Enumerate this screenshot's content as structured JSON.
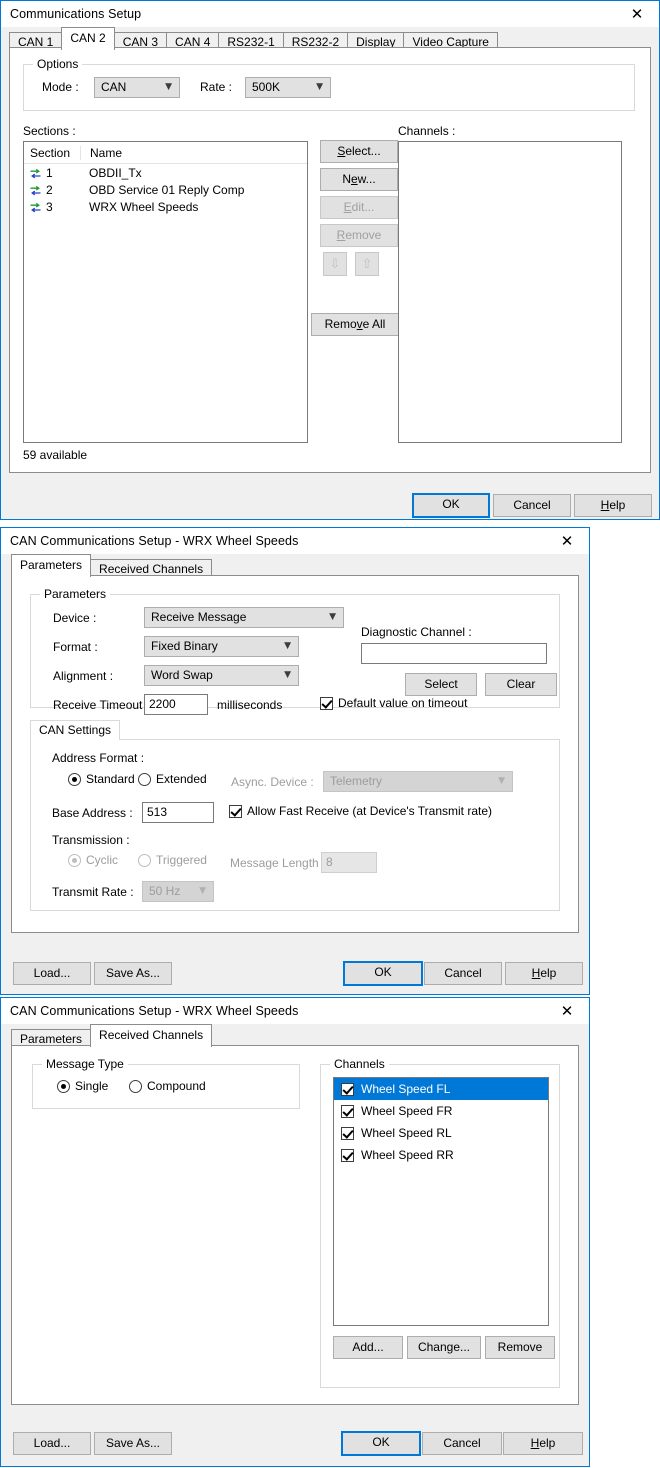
{
  "comm_setup": {
    "title": "Communications Setup",
    "close_icon": "close-icon",
    "tabs": [
      {
        "label": "CAN 1",
        "active": false
      },
      {
        "label": "CAN 2",
        "active": true
      },
      {
        "label": "CAN 3",
        "active": false
      },
      {
        "label": "CAN 4",
        "active": false
      },
      {
        "label": "RS232-1",
        "active": false
      },
      {
        "label": "RS232-2",
        "active": false
      },
      {
        "label": "Display",
        "active": false
      },
      {
        "label": "Video Capture",
        "active": false
      }
    ],
    "options": {
      "group_label": "Options",
      "mode_label": "Mode :",
      "mode_value": "CAN",
      "rate_label": "Rate :",
      "rate_value": "500K"
    },
    "sections": {
      "label": "Sections :",
      "columns": [
        "Section",
        "Name"
      ],
      "rows": [
        {
          "icon": "transfer-arrows-icon",
          "num": "1",
          "name": "OBDII_Tx"
        },
        {
          "icon": "transfer-arrows-icon",
          "num": "2",
          "name": "OBD Service 01 Reply Comp"
        },
        {
          "icon": "transfer-arrows-icon",
          "num": "3",
          "name": "WRX Wheel Speeds"
        }
      ],
      "status": "59 available"
    },
    "channels": {
      "label": "Channels :",
      "items": []
    },
    "side_buttons": [
      {
        "label": "Select...",
        "mnemonic": "S",
        "enabled": true
      },
      {
        "label": "New...",
        "mnemonic": "e",
        "enabled": true
      },
      {
        "label": "Edit...",
        "mnemonic": "E",
        "enabled": false
      },
      {
        "label": "Remove",
        "mnemonic": "R",
        "enabled": false
      }
    ],
    "move_down_icon": "arrow-down-icon",
    "move_up_icon": "arrow-up-icon",
    "remove_all_label": "Remove All",
    "footer": {
      "ok": "OK",
      "cancel": "Cancel",
      "help": "Help"
    }
  },
  "can_params": {
    "title": "CAN Communications Setup - WRX Wheel Speeds",
    "close_icon": "close-icon",
    "tabs": [
      {
        "label": "Parameters",
        "active": true
      },
      {
        "label": "Received Channels",
        "active": false
      }
    ],
    "parameters": {
      "group_label": "Parameters",
      "device_label": "Device :",
      "device_value": "Receive Message",
      "format_label": "Format :",
      "format_value": "Fixed Binary",
      "alignment_label": "Alignment :",
      "alignment_value": "Word Swap",
      "timeout_label": "Receive Timeout :",
      "timeout_value": "2200",
      "timeout_units": "milliseconds",
      "default_on_timeout_label": "Default value on timeout",
      "default_on_timeout_checked": true,
      "diagnostic_label": "Diagnostic Channel :",
      "diagnostic_value": "",
      "select_label": "Select",
      "clear_label": "Clear"
    },
    "can_settings": {
      "tab_label": "CAN Settings",
      "address_format_label": "Address Format :",
      "standard_label": "Standard",
      "standard_selected": true,
      "extended_label": "Extended",
      "async_device_label": "Async. Device :",
      "async_device_value": "Telemetry",
      "async_device_enabled": false,
      "base_address_label": "Base Address :",
      "base_address_value": "513",
      "fast_receive_label": "Allow Fast Receive (at Device's Transmit rate)",
      "fast_receive_checked": true,
      "transmission_label": "Transmission :",
      "cyclic_label": "Cyclic",
      "cyclic_selected": true,
      "triggered_label": "Triggered",
      "message_length_label": "Message Length :",
      "message_length_value": "8",
      "transmit_rate_label": "Transmit Rate :",
      "transmit_rate_value": "50 Hz",
      "transmission_enabled": false
    },
    "footer": {
      "load": "Load...",
      "save_as": "Save As...",
      "ok": "OK",
      "cancel": "Cancel",
      "help": "Help"
    }
  },
  "can_received": {
    "title": "CAN Communications Setup - WRX Wheel Speeds",
    "close_icon": "close-icon",
    "tabs": [
      {
        "label": "Parameters",
        "active": false
      },
      {
        "label": "Received Channels",
        "active": true
      }
    ],
    "message_type": {
      "group_label": "Message Type",
      "single_label": "Single",
      "single_selected": true,
      "compound_label": "Compound"
    },
    "channels": {
      "group_label": "Channels",
      "items": [
        {
          "label": "Wheel Speed FL",
          "checked": true,
          "selected": true
        },
        {
          "label": "Wheel Speed FR",
          "checked": true,
          "selected": false
        },
        {
          "label": "Wheel Speed RL",
          "checked": true,
          "selected": false
        },
        {
          "label": "Wheel Speed RR",
          "checked": true,
          "selected": false
        }
      ],
      "add_label": "Add...",
      "change_label": "Change...",
      "remove_label": "Remove"
    },
    "footer": {
      "load": "Load...",
      "save_as": "Save As...",
      "ok": "OK",
      "cancel": "Cancel",
      "help": "Help"
    }
  },
  "colors": {
    "window_border": "#0078d7",
    "dialog_bg": "#f0f0f0",
    "selection": "#0078d7",
    "icon_green": "#1d9a34",
    "icon_blue": "#2a3fc4",
    "disabled_text": "#9d9d9d"
  }
}
